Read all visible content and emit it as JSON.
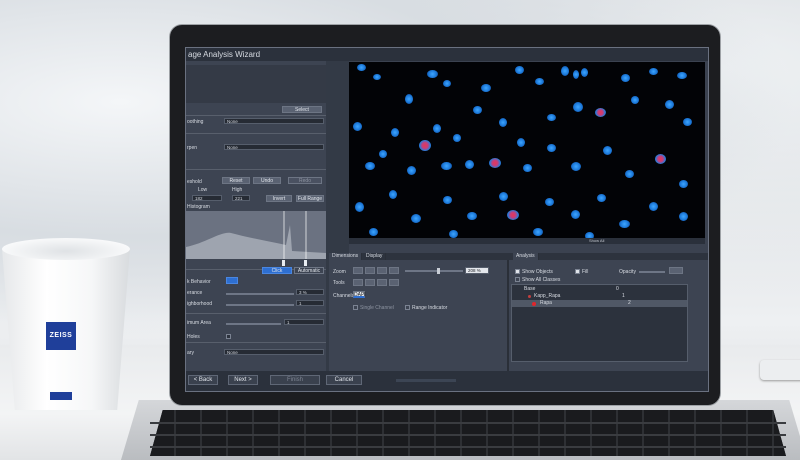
{
  "app": {
    "title": "age Analysis Wizard"
  },
  "left_panel": {
    "select_label": "Select",
    "smoothing_label": "oothing",
    "smoothing_value": "None",
    "sharpen_label": "rpen",
    "sharpen_value": "None",
    "threshold_label": "eshold",
    "reset_label": "Reset",
    "undo_label": "Undo",
    "redo_label": "Redo",
    "low_label": "Low",
    "high_label": "High",
    "low_value": "182",
    "high_value": "221",
    "invert_label": "Invert",
    "full_range_label": "Full Range",
    "histogram_label": "Histogram",
    "behavior_label": "k Behavior",
    "click_label": "Click",
    "automatic_label": "Automatic",
    "tolerance_label": "erance",
    "tolerance_value": "3 %",
    "neighborhood_label": "ighborhood",
    "neighborhood_value": "1",
    "min_area_label": "imum Area",
    "min_area_value": "1",
    "holes_label": "Holes",
    "binary_label": "ary",
    "binary_value": "None"
  },
  "image_view": {
    "show_all_label": "Show All"
  },
  "bottom_panel": {
    "tabs": [
      "Dimensions",
      "Display"
    ],
    "zoom_label": "Zoom",
    "zoom_value": "208 %",
    "tools_label": "Tools",
    "channels_label": "Channels",
    "channel_name": "DAPI",
    "single_channel_label": "Single Channel",
    "range_indicator_label": "Range Indicator"
  },
  "analysis_panel": {
    "tab": "Analysis",
    "show_objects_label": "Show Objects",
    "fill_label": "Fill",
    "opacity_label": "Opacity",
    "show_all_classes_label": "Show All Classes",
    "rows": [
      {
        "name": "Base",
        "count": "0"
      },
      {
        "name": "Kapp_Rapa",
        "count": "1"
      },
      {
        "name": "Rapa",
        "count": "2"
      }
    ]
  },
  "footer": {
    "back_label": "< Back",
    "next_label": "Next >",
    "finish_label": "Finish",
    "cancel_label": "Cancel"
  },
  "cup": {
    "brand": "ZEISS"
  },
  "colors": {
    "ui_panel": "#3d4452",
    "accent_blue": "#2e6fd1",
    "nucleus_blue": "#1c78d8",
    "nucleus_red": "#e6365a"
  }
}
